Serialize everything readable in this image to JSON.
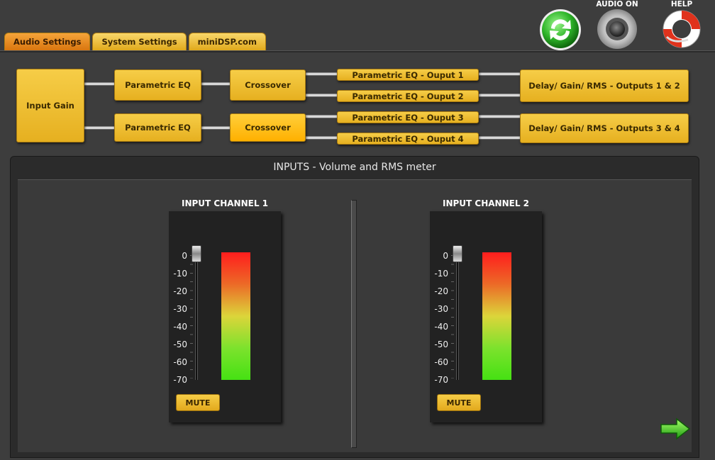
{
  "tabs": [
    {
      "label": "Audio Settings",
      "active": true
    },
    {
      "label": "System Settings",
      "active": false
    },
    {
      "label": "miniDSP.com",
      "active": false
    }
  ],
  "toolbar": {
    "refresh_icon": "refresh-icon",
    "audio_label": "AUDIO ON",
    "help_label": "HELP"
  },
  "flow": {
    "input_gain": "Input Gain",
    "peq1": "Parametric EQ",
    "peq2": "Parametric EQ",
    "crossover1": "Crossover",
    "crossover2": "Crossover",
    "out1": "Parametric EQ - Ouput 1",
    "out2": "Parametric EQ - Ouput 2",
    "out3": "Parametric EQ - Ouput 3",
    "out4": "Parametric EQ - Ouput 4",
    "delay12": "Delay/ Gain/ RMS - Outputs 1 & 2",
    "delay34": "Delay/ Gain/ RMS - Outputs 3 & 4"
  },
  "panel": {
    "title": "INPUTS - Volume and RMS meter",
    "scale": [
      "0",
      "-10",
      "-20",
      "-30",
      "-40",
      "-50",
      "-60",
      "-70"
    ],
    "channels": [
      {
        "title": "INPUT CHANNEL 1",
        "mute_label": "MUTE",
        "volume_db": 0
      },
      {
        "title": "INPUT CHANNEL 2",
        "mute_label": "MUTE",
        "volume_db": 0
      }
    ]
  },
  "colors": {
    "accent": "#e6b020",
    "active_tab": "#d9760f",
    "meter_top": "#ff1d1d",
    "meter_bottom": "#45e113"
  }
}
